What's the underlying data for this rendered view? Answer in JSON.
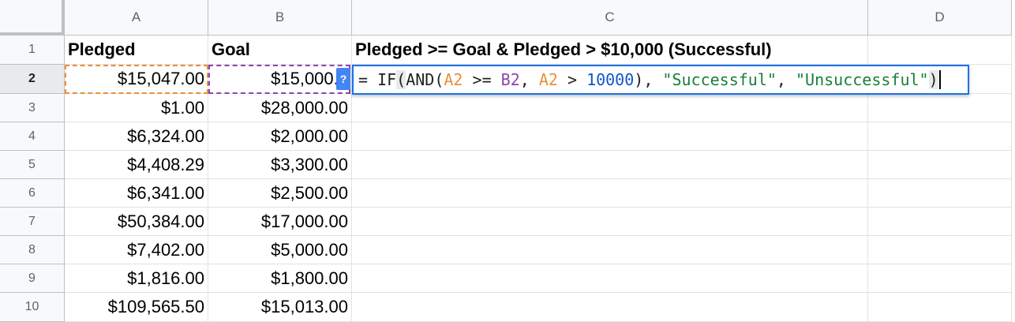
{
  "columns": [
    "A",
    "B",
    "C",
    "D"
  ],
  "rows": [
    "1",
    "2",
    "3",
    "4",
    "5",
    "6",
    "7",
    "8",
    "9",
    "10"
  ],
  "header_row": {
    "a": "Pledged",
    "b": "Goal",
    "c": "Pledged >= Goal & Pledged > $10,000 (Successful)"
  },
  "data_rows": [
    {
      "pledged": "$15,047.00",
      "goal": "$15,000.0"
    },
    {
      "pledged": "$1.00",
      "goal": "$28,000.00"
    },
    {
      "pledged": "$6,324.00",
      "goal": "$2,000.00"
    },
    {
      "pledged": "$4,408.29",
      "goal": "$3,300.00"
    },
    {
      "pledged": "$6,341.00",
      "goal": "$2,500.00"
    },
    {
      "pledged": "$50,384.00",
      "goal": "$17,000.00"
    },
    {
      "pledged": "$7,402.00",
      "goal": "$5,000.00"
    },
    {
      "pledged": "$1,816.00",
      "goal": "$1,800.00"
    },
    {
      "pledged": "$109,565.50",
      "goal": "$15,013.00"
    }
  ],
  "formula": {
    "help_badge": "?",
    "t1": "= IF",
    "t2": "(",
    "t3": "AND(",
    "ref_a": "A2",
    "t4": " >= ",
    "ref_b": "B2",
    "t5": ", ",
    "ref_a2": "A2",
    "t6": " > ",
    "num": "10000",
    "t7": "), ",
    "str1": "\"Successful\"",
    "t8": ", ",
    "str2": "\"Unsuccessful\"",
    "t9": ")"
  },
  "colors": {
    "ref_a": "#e69138",
    "ref_b": "#8e44ad",
    "number": "#1155cc",
    "string": "#188038",
    "editor_border": "#1a73e8"
  }
}
